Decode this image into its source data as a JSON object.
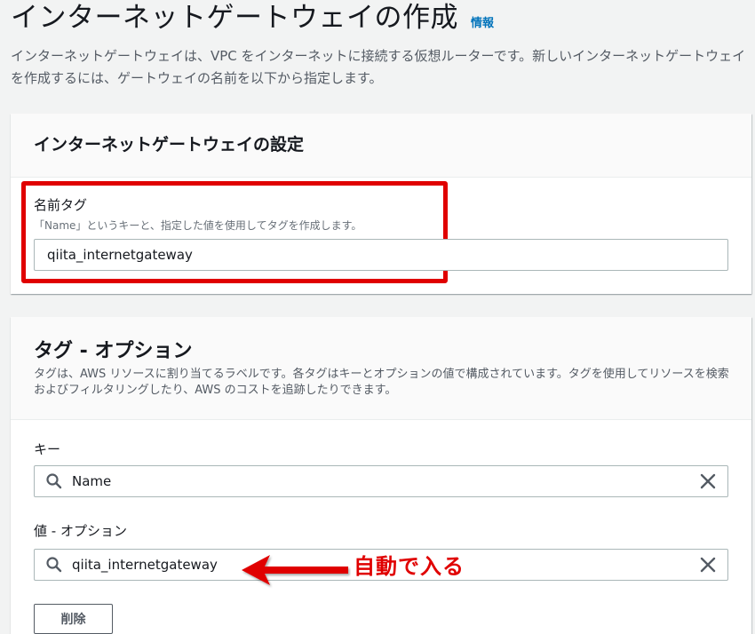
{
  "header": {
    "title": "インターネットゲートウェイの作成",
    "info_link": "情報",
    "description": "インターネットゲートウェイは、VPC をインターネットに接続する仮想ルーターです。新しいインターネットゲートウェイを作成するには、ゲートウェイの名前を以下から指定します。"
  },
  "settings": {
    "title": "インターネットゲートウェイの設定",
    "name_tag_label": "名前タグ",
    "name_tag_desc": "「Name」というキーと、指定した値を使用してタグを作成します。",
    "name_tag_value": "qiita_internetgateway"
  },
  "tags": {
    "title": "タグ - オプション",
    "description": "タグは、AWS リソースに割り当てるラベルです。各タグはキーとオプションの値で構成されています。タグを使用してリソースを検索およびフィルタリングしたり、AWS のコストを追跡したりできます。",
    "key_label": "キー",
    "key_value": "Name",
    "value_label": "値 - オプション",
    "value_value": "qiita_internetgateway",
    "delete_label": "削除"
  },
  "annotation": {
    "text": "自動で入る",
    "color": "#e00000"
  },
  "colors": {
    "link": "#0073bb",
    "border": "#aab7b8"
  },
  "icons": [
    "search-icon",
    "close-icon",
    "arrow-icon"
  ]
}
